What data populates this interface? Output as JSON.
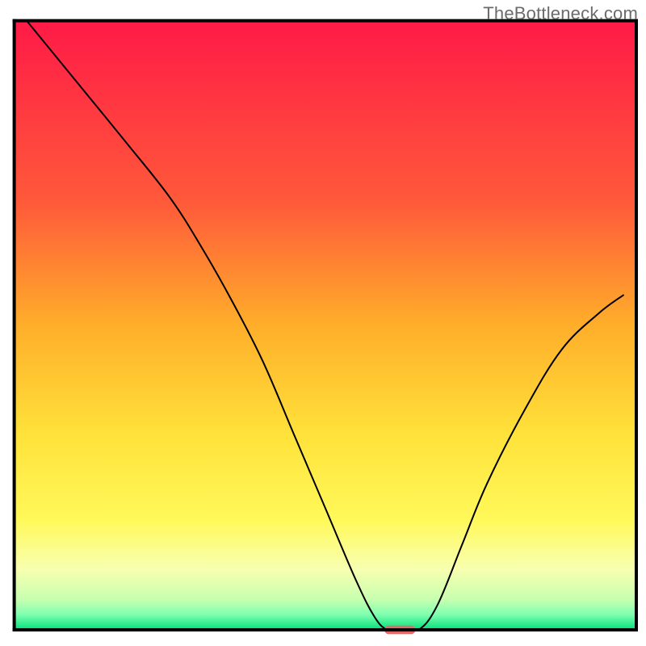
{
  "watermark": "TheBottleneck.com",
  "chart_data": {
    "type": "line",
    "title": "",
    "xlabel": "",
    "ylabel": "",
    "xlim": [
      0,
      100
    ],
    "ylim": [
      0,
      100
    ],
    "grid": false,
    "legend": false,
    "background": {
      "type": "vertical-gradient",
      "stops": [
        {
          "pos": 0.0,
          "color": "#ff1a47"
        },
        {
          "pos": 0.3,
          "color": "#ff5a3a"
        },
        {
          "pos": 0.5,
          "color": "#ffae2a"
        },
        {
          "pos": 0.68,
          "color": "#ffe23a"
        },
        {
          "pos": 0.82,
          "color": "#fff95a"
        },
        {
          "pos": 0.9,
          "color": "#f8ffb0"
        },
        {
          "pos": 0.95,
          "color": "#c8ffb0"
        },
        {
          "pos": 0.975,
          "color": "#7fffb0"
        },
        {
          "pos": 1.0,
          "color": "#00e07a"
        }
      ]
    },
    "series": [
      {
        "name": "bottleneck-curve",
        "color": "#000000",
        "stroke_width": 2,
        "x": [
          2.0,
          10.0,
          18.0,
          25.0,
          30.0,
          35.0,
          40.0,
          45.0,
          50.0,
          55.0,
          58.0,
          60.0,
          62.0,
          65.0,
          68.0,
          72.0,
          76.0,
          82.0,
          88.0,
          94.0,
          98.0
        ],
        "y": [
          100.0,
          90.0,
          80.0,
          71.0,
          63.0,
          54.0,
          44.0,
          32.0,
          20.0,
          8.0,
          2.0,
          0.0,
          0.0,
          0.0,
          4.0,
          14.0,
          24.0,
          36.0,
          46.0,
          52.0,
          55.0
        ]
      }
    ],
    "marker": {
      "name": "optimal-marker",
      "shape": "pill",
      "color": "#e46a6a",
      "x_center": 62,
      "y": 0,
      "width": 5,
      "height": 1.4
    },
    "axes": {
      "box_color": "#000000",
      "box_stroke": 4,
      "inner_left": 2.2,
      "inner_right": 98.5,
      "inner_top": 3.2,
      "inner_bottom": 97.5
    }
  }
}
